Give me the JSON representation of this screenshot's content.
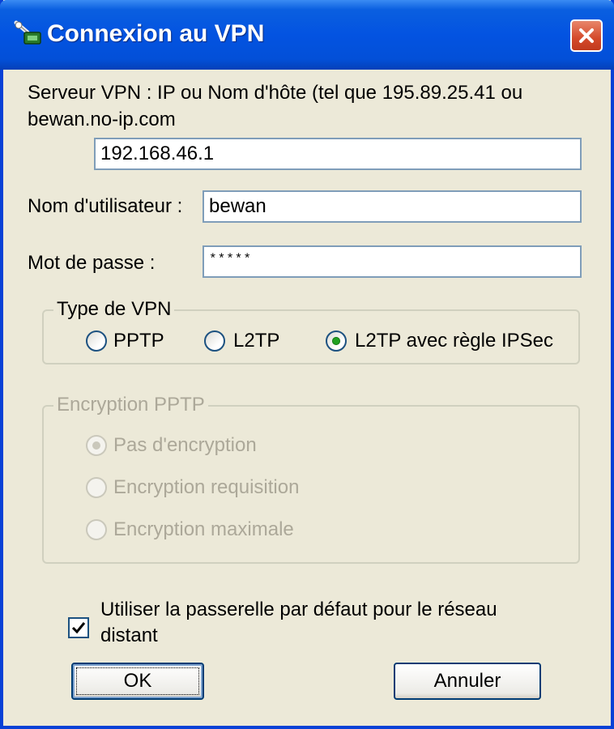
{
  "window": {
    "title": "Connexion au VPN",
    "title_icon": "vpn-connection-icon",
    "close_icon": "close-icon"
  },
  "server": {
    "label_line1": "Serveur VPN : IP ou Nom d'hôte (tel que 195.89.25.41 ou",
    "label_line2": "bewan.no-ip.com",
    "value": "192.168.46.1"
  },
  "username": {
    "label": "Nom d'utilisateur :",
    "value": "bewan"
  },
  "password": {
    "label": "Mot de passe :",
    "value": "*****"
  },
  "vpn_type": {
    "legend": "Type de VPN",
    "options": [
      {
        "label": "PPTP",
        "checked": false
      },
      {
        "label": "L2TP",
        "checked": false
      },
      {
        "label": "L2TP avec règle IPSec",
        "checked": true
      }
    ]
  },
  "encryption": {
    "legend": "Encryption PPTP",
    "disabled": true,
    "options": [
      {
        "label": "Pas d'encryption",
        "checked": true
      },
      {
        "label": "Encryption requisition",
        "checked": false
      },
      {
        "label": "Encryption maximale",
        "checked": false
      }
    ]
  },
  "gateway": {
    "label_line1": "Utiliser la passerelle par défaut pour le réseau",
    "label_line2": "distant",
    "checked": true
  },
  "buttons": {
    "ok": "OK",
    "cancel": "Annuler"
  },
  "colors": {
    "titlebar": "#0353e1",
    "window_bg": "#ece9d8",
    "close_button": "#d4492a",
    "disabled_text": "#aca899"
  }
}
